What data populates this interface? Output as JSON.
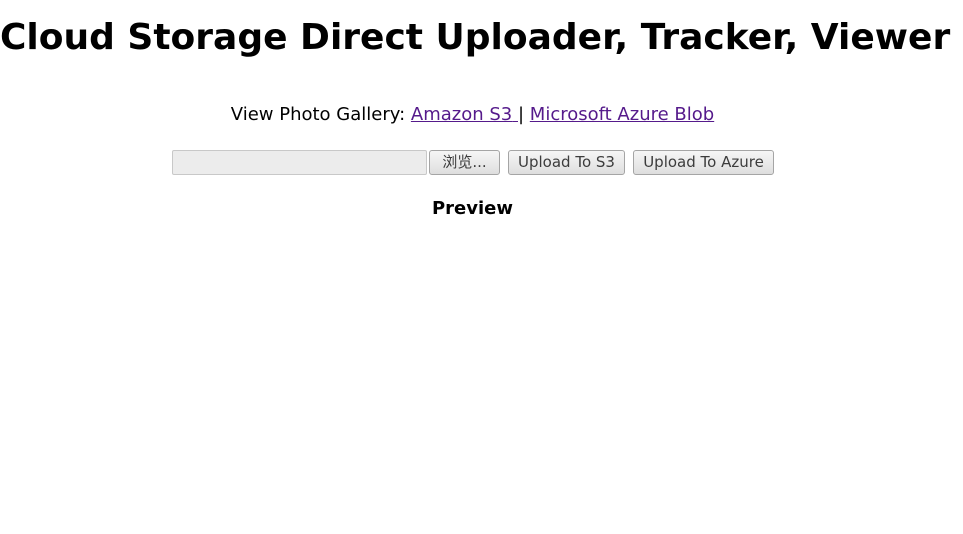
{
  "page": {
    "title": "Cloud Storage Direct Uploader, Tracker, Viewer"
  },
  "gallery": {
    "label": "View Photo Gallery:",
    "links": [
      {
        "label": "Amazon S3"
      },
      {
        "label": "Microsoft Azure Blob"
      }
    ],
    "separator": "|"
  },
  "upload": {
    "file_path_value": "",
    "browse_label": "浏览...",
    "upload_s3_label": "Upload To S3",
    "upload_azure_label": "Upload To Azure"
  },
  "preview": {
    "heading": "Preview"
  }
}
